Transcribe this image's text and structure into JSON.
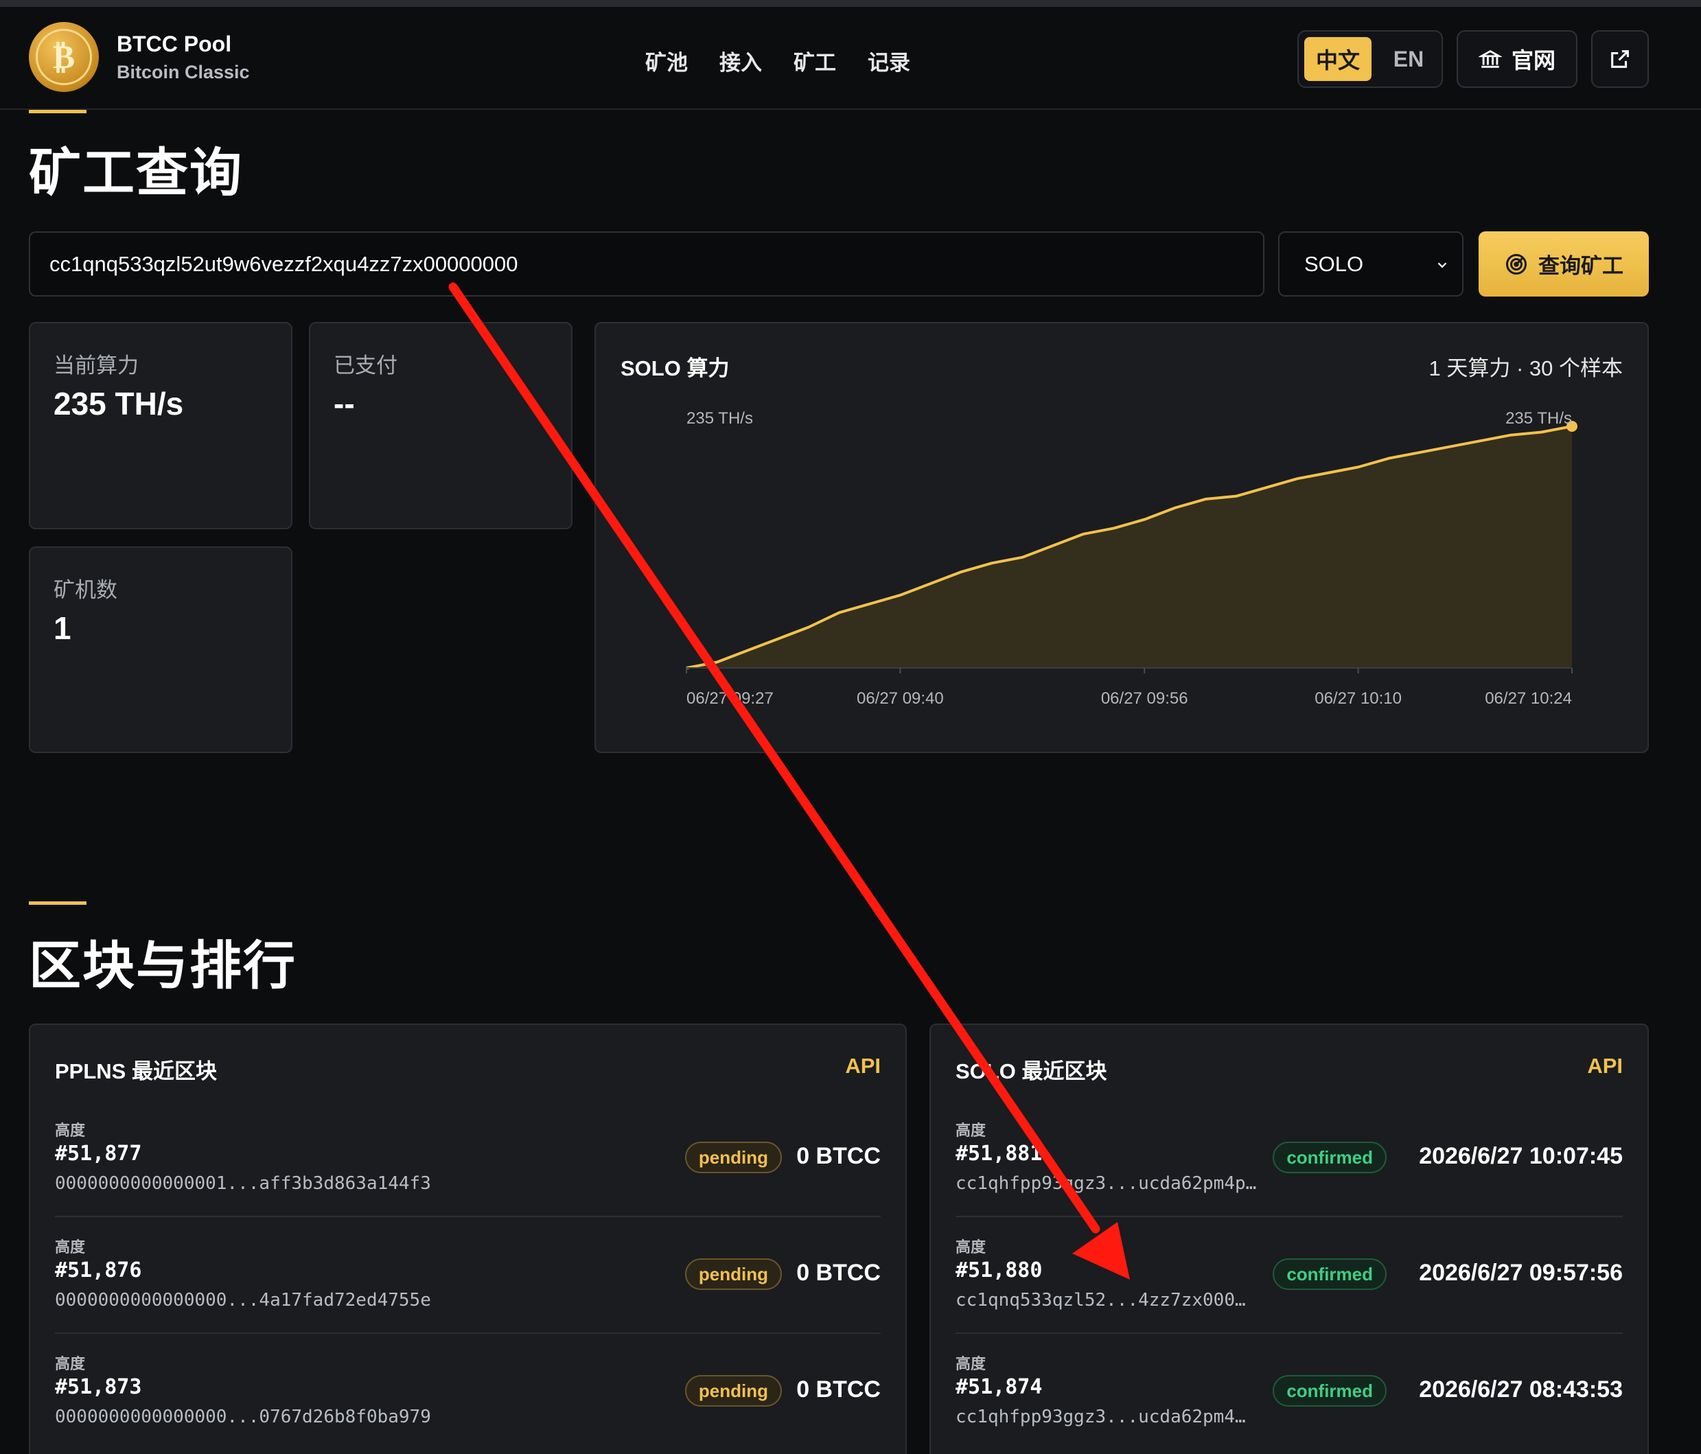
{
  "header": {
    "brand_name": "BTCC Pool",
    "brand_sub": "Bitcoin Classic",
    "logo_icon": "btcc-coin-logo",
    "nav": [
      "矿池",
      "接入",
      "矿工",
      "记录"
    ],
    "lang_zh": "中文",
    "lang_en": "EN",
    "site_label": "官网"
  },
  "query": {
    "title": "矿工查询",
    "address": "cc1qnq533qzl52ut9w6vezzf2xqu4zz7zx00000000",
    "mode": "SOLO",
    "button": "查询矿工"
  },
  "stats": {
    "hashrate_label": "当前算力",
    "hashrate_value": "235 TH/s",
    "paid_label": "已支付",
    "paid_value": "--",
    "workers_label": "矿机数",
    "workers_value": "1"
  },
  "chart_panel": {
    "title": "SOLO 算力",
    "meta": "1 天算力 · 30 个样本"
  },
  "chart_data": {
    "type": "area",
    "title": "SOLO 算力",
    "x_ticks": [
      "06/27 09:27",
      "06/27 09:40",
      "06/27 09:56",
      "06/27 10:10",
      "06/27 10:24"
    ],
    "y_start_label": "235 TH/s",
    "y_end_label": "235 TH/s",
    "series": [
      {
        "values": [
          0,
          2,
          6,
          10,
          14,
          19,
          22,
          25,
          29,
          33,
          36,
          38,
          42,
          46,
          48,
          51,
          55,
          58,
          59,
          62,
          65,
          67,
          69,
          72,
          74,
          76,
          78,
          80,
          81,
          83
        ]
      }
    ],
    "ylim": [
      0,
      83
    ],
    "grid": false,
    "colors": {
      "line": "#f2c14e",
      "fill": "#3a321c"
    }
  },
  "blocks": {
    "section_title": "区块与排行",
    "pplns": {
      "title": "PPLNS 最近区块",
      "api": "API",
      "rows": [
        {
          "label": "高度",
          "height": "#51,877",
          "hash": "0000000000000001...aff3b3d863a144f3",
          "status": "pending",
          "amount": "0 BTCC"
        },
        {
          "label": "高度",
          "height": "#51,876",
          "hash": "0000000000000000...4a17fad72ed4755e",
          "status": "pending",
          "amount": "0 BTCC"
        },
        {
          "label": "高度",
          "height": "#51,873",
          "hash": "0000000000000000...0767d26b8f0ba979",
          "status": "pending",
          "amount": "0 BTCC"
        }
      ]
    },
    "solo": {
      "title": "SOLO 最近区块",
      "api": "API",
      "rows": [
        {
          "label": "高度",
          "height": "#51,881",
          "hash": "cc1qhfpp93ggz3...ucda62pm4p…",
          "status": "confirmed",
          "amount": "2026/6/27 10:07:45"
        },
        {
          "label": "高度",
          "height": "#51,880",
          "hash": "cc1qnq533qzl52...4zz7zx000…",
          "status": "confirmed",
          "amount": "2026/6/27 09:57:56"
        },
        {
          "label": "高度",
          "height": "#51,874",
          "hash": "cc1qhfpp93ggz3...ucda62pm4…",
          "status": "confirmed",
          "amount": "2026/6/27 08:43:53"
        }
      ]
    }
  },
  "annotation": {
    "color": "#ff1a0f"
  }
}
